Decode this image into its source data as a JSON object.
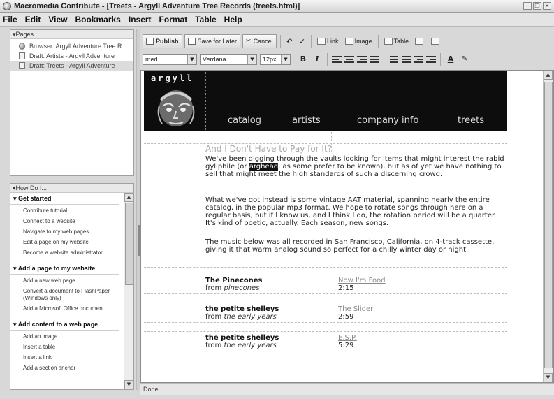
{
  "window": {
    "title": "Macromedia Contribute - [Treets - Argyll Adventure Tree Records (treets.html)]"
  },
  "menu": [
    "File",
    "Edit",
    "View",
    "Bookmarks",
    "Insert",
    "Format",
    "Table",
    "Help"
  ],
  "pages_panel": {
    "header": "Pages",
    "items": [
      {
        "label": "Browser: Argyll Adventure Tree R",
        "icon": "globe-icon"
      },
      {
        "label": "Draft: Artists - Argyll Adventure",
        "icon": "page-icon"
      },
      {
        "label": "Draft: Treets - Argyll Adventure",
        "icon": "page-icon",
        "selected": true
      }
    ]
  },
  "howdo_panel": {
    "header": "How Do I...",
    "sections": [
      {
        "title": "Get started",
        "items": [
          "Contribute tutorial",
          "Connect to a website",
          "Navigate to my web pages",
          "Edit a page on my website",
          "Become a website administrator"
        ]
      },
      {
        "title": "Add a page to my website",
        "items": [
          "Add a new web page",
          "Convert a document to FlashPaper (Windows only)",
          "Add a Microsoft Office document"
        ]
      },
      {
        "title": "Add content to a web page",
        "items": [
          "Add an image",
          "Insert a table",
          "Insert a link",
          "Add a section anchor"
        ]
      }
    ]
  },
  "toolbar": {
    "publish": "Publish",
    "save_for_later": "Save for Later",
    "cancel": "Cancel",
    "link": "Link",
    "image": "Image",
    "table": "Table"
  },
  "format_bar": {
    "style": "med",
    "font": "Verdana",
    "size": "12px",
    "bold": "B",
    "italic": "I",
    "text_color": "A"
  },
  "page": {
    "logo": "argyll",
    "nav": [
      "catalog",
      "artists",
      "company info",
      "treets"
    ],
    "article_title": "And I Don't Have to Pay for It?",
    "para1_before": "We've been digging through the vaults looking for items that might interest the rabid gyllphile (or ",
    "para1_highlight": "arghead",
    "para1_after": ", as some prefer to be known), but as of yet we have nothing to sell that might meet the high standards of such a discerning crowd.",
    "para2": "What we've got instead is some vintage AAT material, spanning nearly the entire catalog, in the popular mp3 format. We hope to rotate songs through here on a regular basis, but if I know us, and I think I do, the rotation period will be a quarter. It's kind of poetic, actually. Each season, new songs.",
    "para3": "The music below was all recorded in San Francisco, California, on 4-track cassette, giving it that warm analog sound so perfect for a chilly winter day or night.",
    "tracks": [
      {
        "artist": "The Pinecones",
        "from": "from",
        "album": "pinecones",
        "title": "Now I'm Food",
        "time": "2:15"
      },
      {
        "artist": "the petite shelleys",
        "from": "from",
        "album": "the early years",
        "title": "The Slider",
        "time": "2:59"
      },
      {
        "artist": "the petite shelleys",
        "from": "from",
        "album": "the early years",
        "title": "E.S.P.",
        "time": "5:29"
      }
    ]
  },
  "status": "Done"
}
